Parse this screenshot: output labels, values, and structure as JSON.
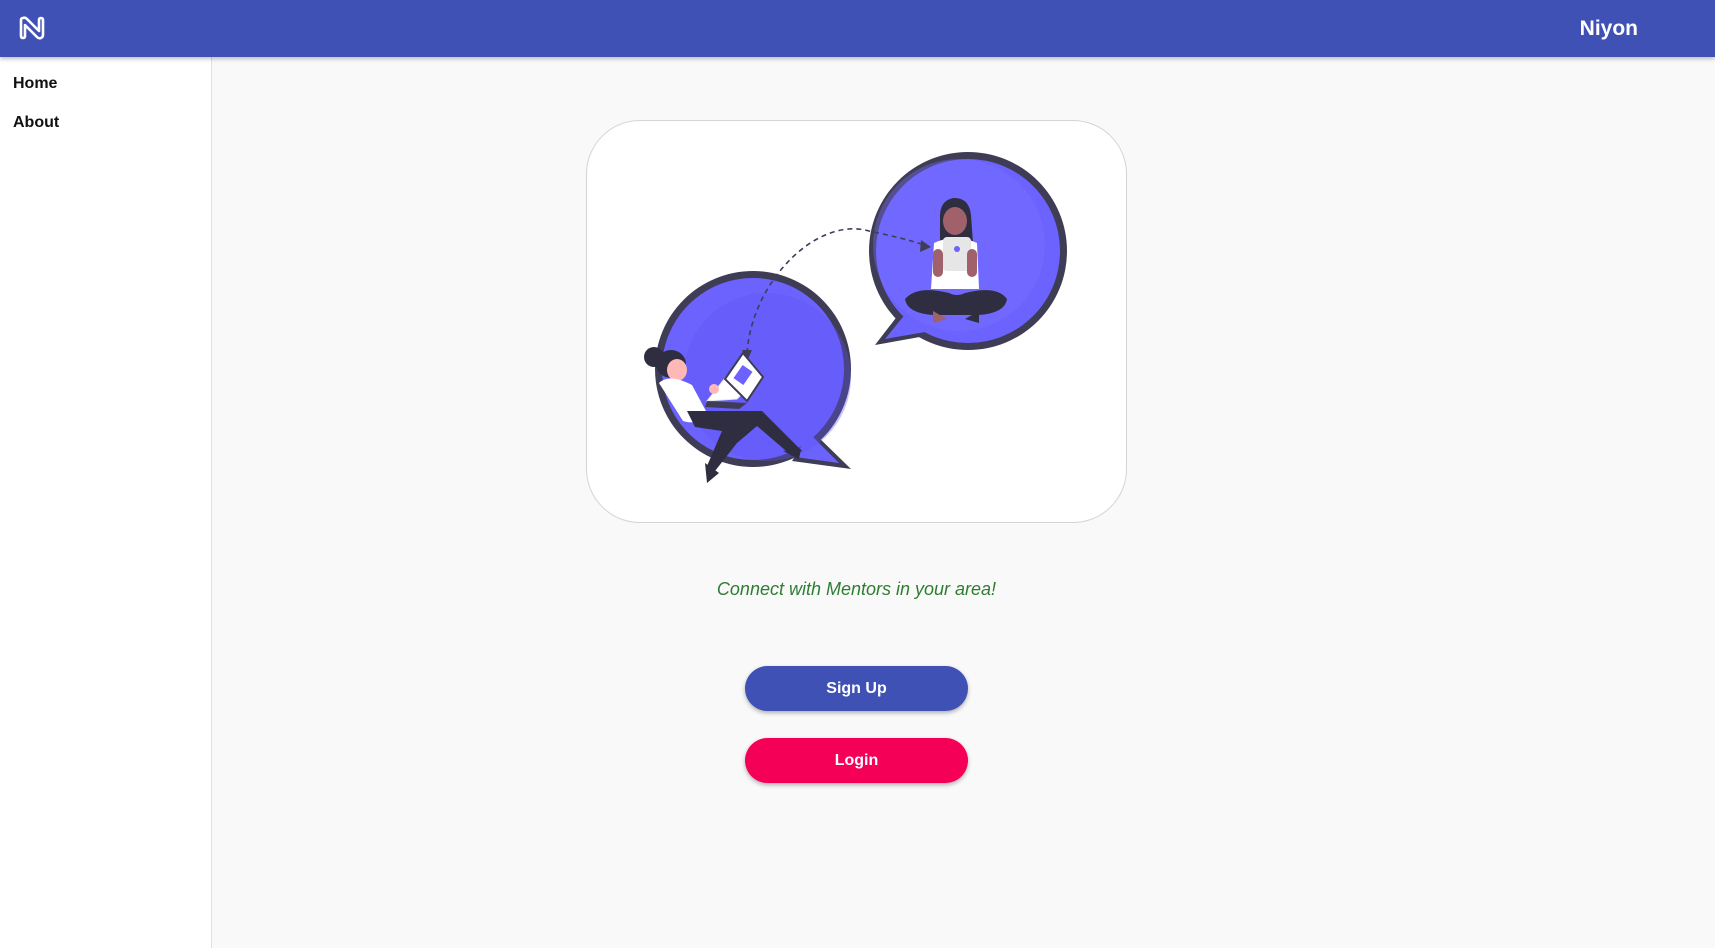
{
  "header": {
    "logo_icon": "n-logo-icon",
    "user_name": "Niyon",
    "color": "#3f51b5"
  },
  "sidebar": {
    "items": [
      {
        "label": "Home"
      },
      {
        "label": "About"
      }
    ]
  },
  "main": {
    "illustration": "mentorship-chat-illustration",
    "tagline": "Connect with Mentors in your area!",
    "tagline_color": "#2e7d32",
    "signup_label": "Sign Up",
    "signup_color": "#3f51b5",
    "login_label": "Login",
    "login_color": "#f50057"
  }
}
